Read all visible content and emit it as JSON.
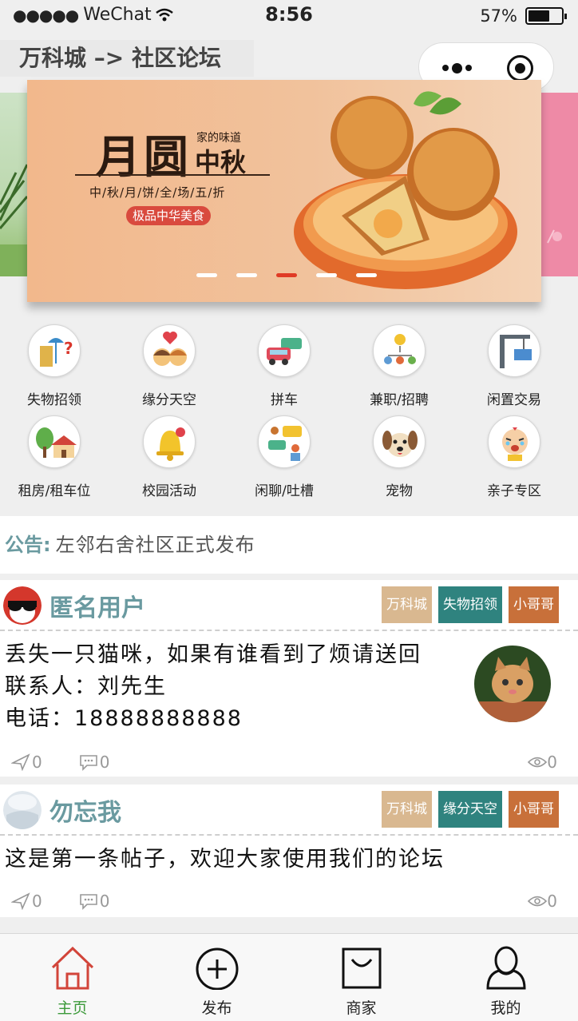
{
  "status_bar": {
    "carrier": "WeChat",
    "time": "8:56",
    "battery": "57%"
  },
  "nav": {
    "title": "万科城 –> 社区论坛"
  },
  "banner": {
    "title_main": "月圆",
    "title_sub_small": "家的味道",
    "title_sub_big": "中秋",
    "subtitle": "中/秋/月/饼/全/场/五/折",
    "pill": "极品中华美食",
    "active_dot": 2
  },
  "categories": [
    {
      "label": "失物招领",
      "icon": "lost-found-icon"
    },
    {
      "label": "缘分天空",
      "icon": "couple-hearts-icon"
    },
    {
      "label": "拼车",
      "icon": "carpool-icon"
    },
    {
      "label": "兼职/招聘",
      "icon": "job-network-icon"
    },
    {
      "label": "闲置交易",
      "icon": "crane-container-icon"
    },
    {
      "label": "租房/租车位",
      "icon": "house-tree-icon"
    },
    {
      "label": "校园活动",
      "icon": "bell-icon"
    },
    {
      "label": "闲聊/吐槽",
      "icon": "chat-people-icon"
    },
    {
      "label": "宠物",
      "icon": "dog-icon"
    },
    {
      "label": "亲子专区",
      "icon": "crying-baby-icon"
    }
  ],
  "notice": {
    "label": "公告:",
    "text": "左邻右舍社区正式发布"
  },
  "posts": [
    {
      "user": "匿名用户",
      "tags": [
        "万科城",
        "失物招领",
        "小哥哥"
      ],
      "lines": [
        "丢失一只猫咪，如果有谁看到了烦请送回",
        "联系人：刘先生",
        "电话：18888888888"
      ],
      "shares": "0",
      "comments": "0",
      "views": "0"
    },
    {
      "user": "勿忘我",
      "tags": [
        "万科城",
        "缘分天空",
        "小哥哥"
      ],
      "lines": [
        "这是第一条帖子，欢迎大家使用我们的论坛"
      ],
      "shares": "0",
      "comments": "0",
      "views": "0"
    }
  ],
  "tabbar": [
    {
      "label": "主页",
      "icon": "home-icon",
      "active": true
    },
    {
      "label": "发布",
      "icon": "plus-circle-icon",
      "active": false
    },
    {
      "label": "商家",
      "icon": "shopping-bag-icon",
      "active": false
    },
    {
      "label": "我的",
      "icon": "user-icon",
      "active": false
    }
  ],
  "colors": {
    "accent_green": "#3c9a3a",
    "tag_teal": "#2f837f",
    "tag_sand": "#d9b890",
    "tag_orange": "#c8703a",
    "username": "#6a9aa0"
  }
}
